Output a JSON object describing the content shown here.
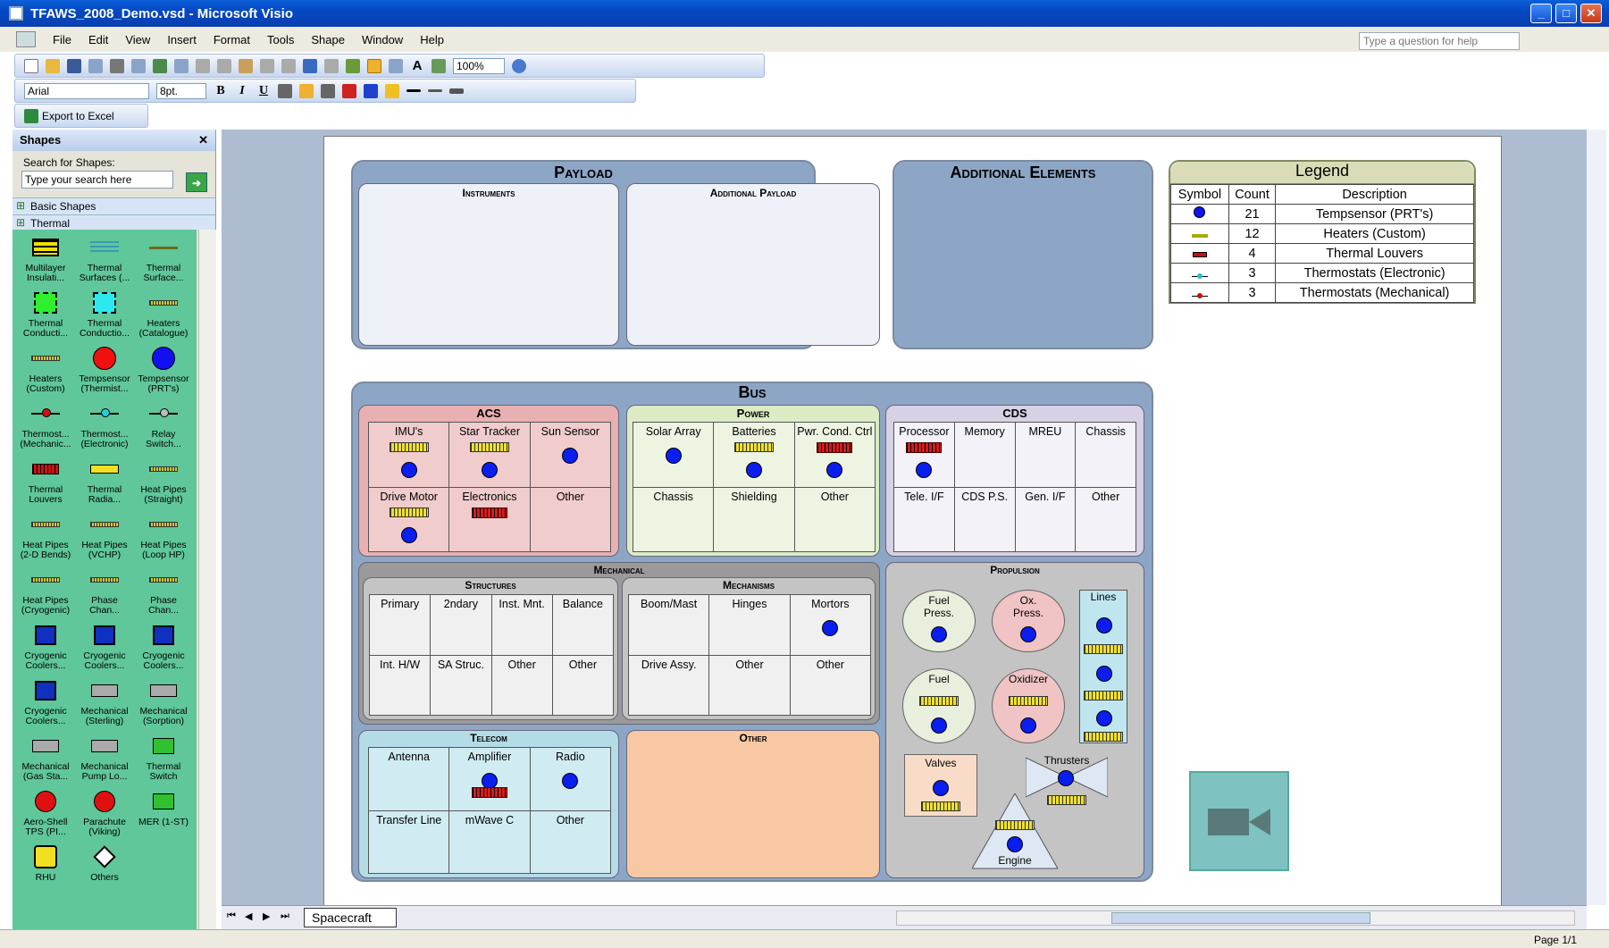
{
  "window": {
    "title": "TFAWS_2008_Demo.vsd - Microsoft Visio"
  },
  "menu": [
    "File",
    "Edit",
    "View",
    "Insert",
    "Format",
    "Tools",
    "Shape",
    "Window",
    "Help"
  ],
  "help_placeholder": "Type a question for help",
  "toolbar": {
    "zoom": "100%",
    "font": "Arial",
    "font_size": "8pt.",
    "export": "Export to Excel"
  },
  "shapes_pane": {
    "title": "Shapes",
    "search_label": "Search for Shapes:",
    "search_placeholder": "Type your search here",
    "stencils": [
      "Basic Shapes",
      "Thermal"
    ],
    "items": [
      {
        "label": "Multilayer Insulati...",
        "icon": "mli-icon"
      },
      {
        "label": "Thermal Surfaces (...",
        "icon": "thermal-surface-icon"
      },
      {
        "label": "Thermal Surface...",
        "icon": "thermal-surface-line-icon"
      },
      {
        "label": "Thermal Conducti...",
        "icon": "thermal-conductor-green-icon"
      },
      {
        "label": "Thermal Conductio...",
        "icon": "thermal-conductor-cyan-icon"
      },
      {
        "label": "Heaters (Catalogue)",
        "icon": "heater-catalogue-icon"
      },
      {
        "label": "Heaters (Custom)",
        "icon": "heater-custom-icon"
      },
      {
        "label": "Tempsensor (Thermist...",
        "icon": "tempsensor-red-icon"
      },
      {
        "label": "Tempsensor (PRT's)",
        "icon": "tempsensor-blue-icon"
      },
      {
        "label": "Thermost... (Mechanic...",
        "icon": "thermostat-mech-icon"
      },
      {
        "label": "Thermost... (Electronic)",
        "icon": "thermostat-elec-icon"
      },
      {
        "label": "Relay Switch...",
        "icon": "relay-switch-icon"
      },
      {
        "label": "Thermal Louvers",
        "icon": "louver-icon"
      },
      {
        "label": "Thermal Radia...",
        "icon": "radiator-icon"
      },
      {
        "label": "Heat Pipes (Straight)",
        "icon": "heatpipe-straight-icon"
      },
      {
        "label": "Heat Pipes (2-D Bends)",
        "icon": "heatpipe-bend-icon"
      },
      {
        "label": "Heat Pipes (VCHP)",
        "icon": "heatpipe-vchp-icon"
      },
      {
        "label": "Heat Pipes (Loop HP)",
        "icon": "heatpipe-loop-icon"
      },
      {
        "label": "Heat Pipes (Cryogenic)",
        "icon": "heatpipe-cryo-icon"
      },
      {
        "label": "Phase Chan...",
        "icon": "phase-change-icon"
      },
      {
        "label": "Phase Chan...",
        "icon": "phase-change-2-icon"
      },
      {
        "label": "Cryogenic Coolers...",
        "icon": "cryocooler-icon"
      },
      {
        "label": "Cryogenic Coolers...",
        "icon": "cryocooler-2-icon"
      },
      {
        "label": "Cryogenic Coolers...",
        "icon": "cryocooler-3-icon"
      },
      {
        "label": "Cryogenic Coolers...",
        "icon": "cryocooler-4-icon"
      },
      {
        "label": "Mechanical (Sterling)",
        "icon": "mech-sterling-icon"
      },
      {
        "label": "Mechanical (Sorption)",
        "icon": "mech-sorption-icon"
      },
      {
        "label": "Mechanical (Gas Sta...",
        "icon": "mech-gas-icon"
      },
      {
        "label": "Mechanical Pump Lo...",
        "icon": "mech-pump-icon"
      },
      {
        "label": "Thermal Switch",
        "icon": "thermal-switch-icon"
      },
      {
        "label": "Aero-Shell TPS (PI...",
        "icon": "aeroshell-icon"
      },
      {
        "label": "Parachute (Viking)",
        "icon": "parachute-icon"
      },
      {
        "label": "MER (1-ST)",
        "icon": "mer-icon"
      },
      {
        "label": "RHU",
        "icon": "rhu-icon"
      },
      {
        "label": "Others",
        "icon": "others-icon"
      }
    ]
  },
  "diagram": {
    "payload": {
      "title": "Payload",
      "instruments": "Instruments",
      "additional": "Additional Payload"
    },
    "additional_elements": "Additional Elements",
    "bus": "Bus",
    "acs": {
      "title": "ACS",
      "cells": [
        "IMU's",
        "Star Tracker",
        "Sun Sensor",
        "Drive Motor",
        "Electronics",
        "Other"
      ]
    },
    "power": {
      "title": "Power",
      "cells": [
        "Solar Array",
        "Batteries",
        "Pwr. Cond. Ctrl",
        "Chassis",
        "Shielding",
        "Other"
      ]
    },
    "cds": {
      "title": "CDS",
      "cells": [
        "Processor",
        "Memory",
        "MREU",
        "Chassis",
        "Tele. I/F",
        "CDS P.S.",
        "Gen. I/F",
        "Other"
      ]
    },
    "mechanical": "Mechanical",
    "structures": {
      "title": "Structures",
      "cells": [
        "Primary",
        "2ndary",
        "Inst. Mnt.",
        "Balance",
        "Int. H/W",
        "SA Struc.",
        "Other",
        "Other"
      ]
    },
    "mechanisms": {
      "title": "Mechanisms",
      "cells": [
        "Boom/Mast",
        "Hinges",
        "Mortors",
        "Drive Assy.",
        "Other",
        "Other"
      ]
    },
    "propulsion": {
      "title": "Propulsion",
      "fuel_press": "Fuel Press.",
      "ox_press": "Ox. Press.",
      "lines": "Lines",
      "fuel": "Fuel",
      "oxidizer": "Oxidizer",
      "valves": "Valves",
      "thrusters": "Thrusters",
      "engine": "Engine"
    },
    "telecom": {
      "title": "Telecom",
      "cells": [
        "Antenna",
        "Amplifier",
        "Radio",
        "Transfer Line",
        "mWave C",
        "Other"
      ]
    },
    "other": "Other"
  },
  "legend": {
    "title": "Legend",
    "headers": [
      "Symbol",
      "Count",
      "Description"
    ],
    "rows": [
      {
        "count": "21",
        "desc": "Tempsensor (PRT's)",
        "icon": "tempsensor-blue-icon"
      },
      {
        "count": "12",
        "desc": "Heaters (Custom)",
        "icon": "heater-custom-icon"
      },
      {
        "count": "4",
        "desc": "Thermal Louvers",
        "icon": "louver-icon"
      },
      {
        "count": "3",
        "desc": "Thermostats (Electronic)",
        "icon": "thermostat-elec-icon"
      },
      {
        "count": "3",
        "desc": "Thermostats (Mechanical)",
        "icon": "thermostat-mech-icon"
      }
    ]
  },
  "sheet_tab": "Spacecraft",
  "status": {
    "page": "Page 1/1"
  }
}
